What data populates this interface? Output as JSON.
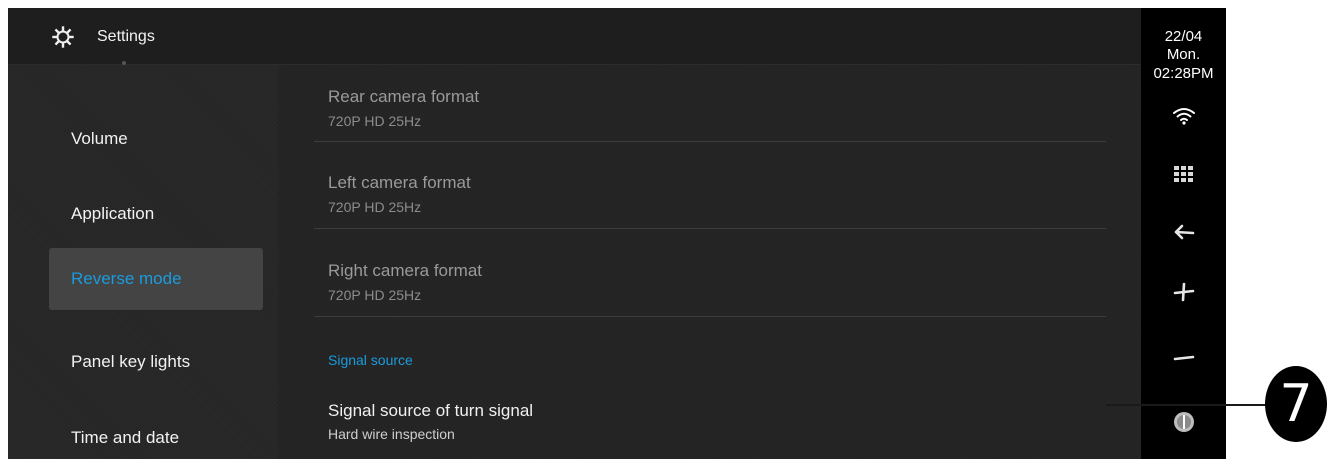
{
  "header": {
    "title": "Settings",
    "icon": "gear-icon"
  },
  "sidebar": {
    "items": [
      {
        "label": "Volume",
        "active": false
      },
      {
        "label": "Application",
        "active": false
      },
      {
        "label": "Reverse mode",
        "active": true
      },
      {
        "label": "Panel key lights",
        "active": false
      },
      {
        "label": "Time and date",
        "active": false
      }
    ]
  },
  "main": {
    "rows": [
      {
        "title": "Rear camera format",
        "value": "720P HD 25Hz"
      },
      {
        "title": "Left camera format",
        "value": "720P HD 25Hz"
      },
      {
        "title": "Right camera format",
        "value": "720P HD 25Hz"
      }
    ],
    "section_header": "Signal source",
    "signal_row": {
      "title": "Signal source of turn signal",
      "value": "Hard wire inspection"
    }
  },
  "status_bar": {
    "date": "22/04",
    "day": "Mon.",
    "time": "02:28PM",
    "icons": [
      "wifi-icon",
      "apps-grid-icon",
      "back-arrow-icon",
      "volume-up-icon",
      "volume-down-icon",
      "power-knob-icon"
    ]
  },
  "callout": {
    "number": "7"
  },
  "colors": {
    "accent": "#1a9bdc",
    "background": "#232323",
    "status_bar": "#000000",
    "active_item": "#444444"
  }
}
